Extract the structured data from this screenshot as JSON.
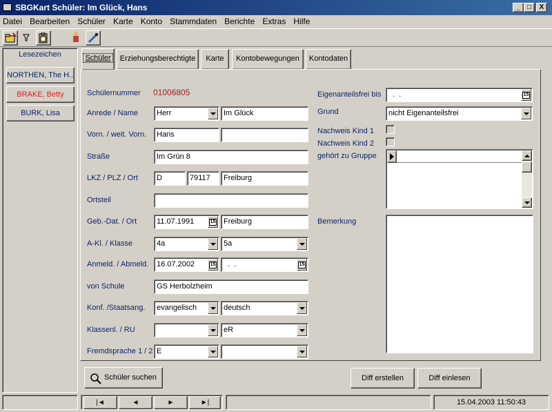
{
  "window": {
    "title": "SBGKart Schüler: Im Glück, Hans",
    "minimize": "_",
    "maximize": "□",
    "close": "X"
  },
  "menu": [
    "Datei",
    "Bearbeiten",
    "Schüler",
    "Karte",
    "Konto",
    "Stammdaten",
    "Berichte",
    "Extras",
    "Hilfe"
  ],
  "sidebar": {
    "title": "Lesezeichen",
    "items": [
      "NORTHEN, The H...",
      "BRAKE, Betty",
      "BURK, Lisa"
    ]
  },
  "tabs": [
    "Schüler",
    "Erziehungsberechtigte",
    "Karte",
    "Kontobewegungen",
    "Kontodaten"
  ],
  "form": {
    "schuelernummer_label": "Schülernummer",
    "schuelernummer": "01006805",
    "anrede_label": "Anrede / Name",
    "anrede": "Herr",
    "name": "Im Glück",
    "vorname_label": "Vorn. / weit. Vorn.",
    "vorname": "Hans",
    "weit_vorname": "",
    "strasse_label": "Straße",
    "strasse": "Im Grün 8",
    "lkz_label": "LKZ / PLZ / Ort",
    "lkz": "D",
    "plz": "79117",
    "ort": "Freiburg",
    "ortsteil_label": "Ortsteil",
    "ortsteil": "",
    "geb_label": "Geb.-Dat. / Ort",
    "geb_datum": "11.07.1991",
    "geb_ort": "Freiburg",
    "klasse_label": "A-Kl. / Klasse",
    "akl": "4a",
    "klasse": "5a",
    "anmeld_label": "Anmeld. / Abmeld.",
    "anmeld": "16.07.2002",
    "abmeld": "  .  .",
    "vonschule_label": "von Schule",
    "vonschule": "GS Herbolzheim",
    "konf_label": "Konf. /Staatsang.",
    "konf": "evangelisch",
    "staatsang": "deutsch",
    "klassenl_label": "Klassenl. / RU",
    "klassenl": "",
    "ru": "eR",
    "fremd_label": "Fremdsprache 1 / 2",
    "fremd1": "E",
    "fremd2": "",
    "eigenanteil_label": "Eigenanteilsfrei bis",
    "eigenanteil": "  .  .",
    "grund_label": "Grund",
    "grund": "nicht Eigenanteilsfrei",
    "nachweis1_label": "Nachweis Kind 1",
    "nachweis2_label": "Nachweis Kind 2",
    "gruppe_label": "gehört zu Gruppe",
    "bemerkung_label": "Bemerkung"
  },
  "buttons": {
    "suchen": "Schüler suchen",
    "diff_erstellen": "Diff erstellen",
    "diff_einlesen": "Diff einlesen"
  },
  "nav": [
    "|◄",
    "◄",
    "►",
    "►|"
  ],
  "status": {
    "datetime": "15.04.2003 11:50:43"
  },
  "calendar_icon_text": "15"
}
